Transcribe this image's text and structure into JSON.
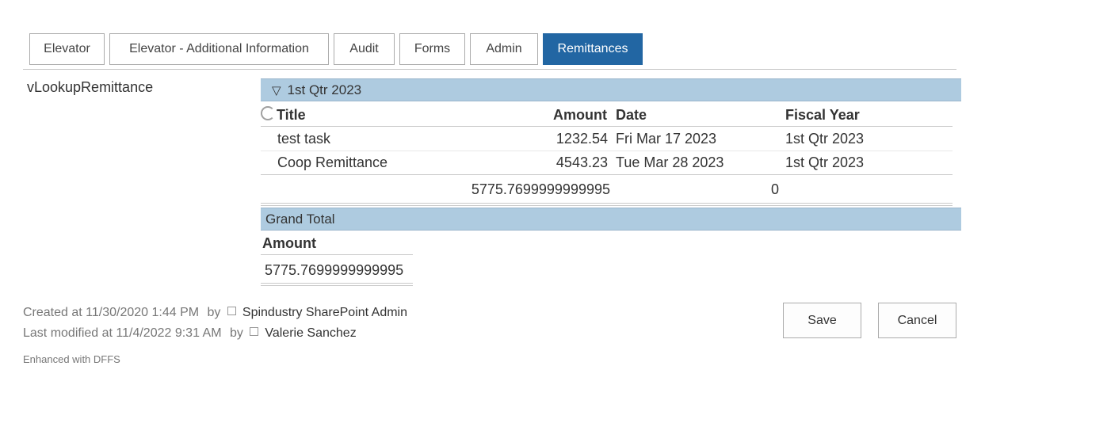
{
  "tabs": [
    {
      "label": "Elevator"
    },
    {
      "label": "Elevator - Additional Information"
    },
    {
      "label": "Audit"
    },
    {
      "label": "Forms"
    },
    {
      "label": "Admin"
    },
    {
      "label": "Remittances",
      "active": true
    }
  ],
  "field": {
    "label": "vLookupRemittance"
  },
  "group": {
    "toggle_icon": "▽",
    "label": "1st Qtr 2023"
  },
  "columns": {
    "title": "Title",
    "amount": "Amount",
    "date": "Date",
    "fiscal_year": "Fiscal Year"
  },
  "rows": [
    {
      "title": "test task",
      "amount": "1232.54",
      "date": "Fri Mar 17 2023",
      "fiscal_year": "1st Qtr 2023"
    },
    {
      "title": "Coop Remittance",
      "amount": "4543.23",
      "date": "Tue Mar 28 2023",
      "fiscal_year": "1st Qtr 2023"
    }
  ],
  "group_totals": {
    "amount": "5775.7699999999995",
    "count": "0"
  },
  "grand_total": {
    "label": "Grand Total",
    "amount_header": "Amount",
    "amount": "5775.7699999999995"
  },
  "meta": {
    "created_prefix": "Created at 11/30/2020 1:44 PM",
    "by": "by",
    "created_by": "Spindustry SharePoint Admin",
    "modified_prefix": "Last modified at 11/4/2022 9:31 AM",
    "modified_by": "Valerie Sanchez",
    "enhanced": "Enhanced with DFFS"
  },
  "buttons": {
    "save": "Save",
    "cancel": "Cancel"
  },
  "colors": {
    "accent": "#2266a3",
    "group_band": "#aecbe0"
  }
}
